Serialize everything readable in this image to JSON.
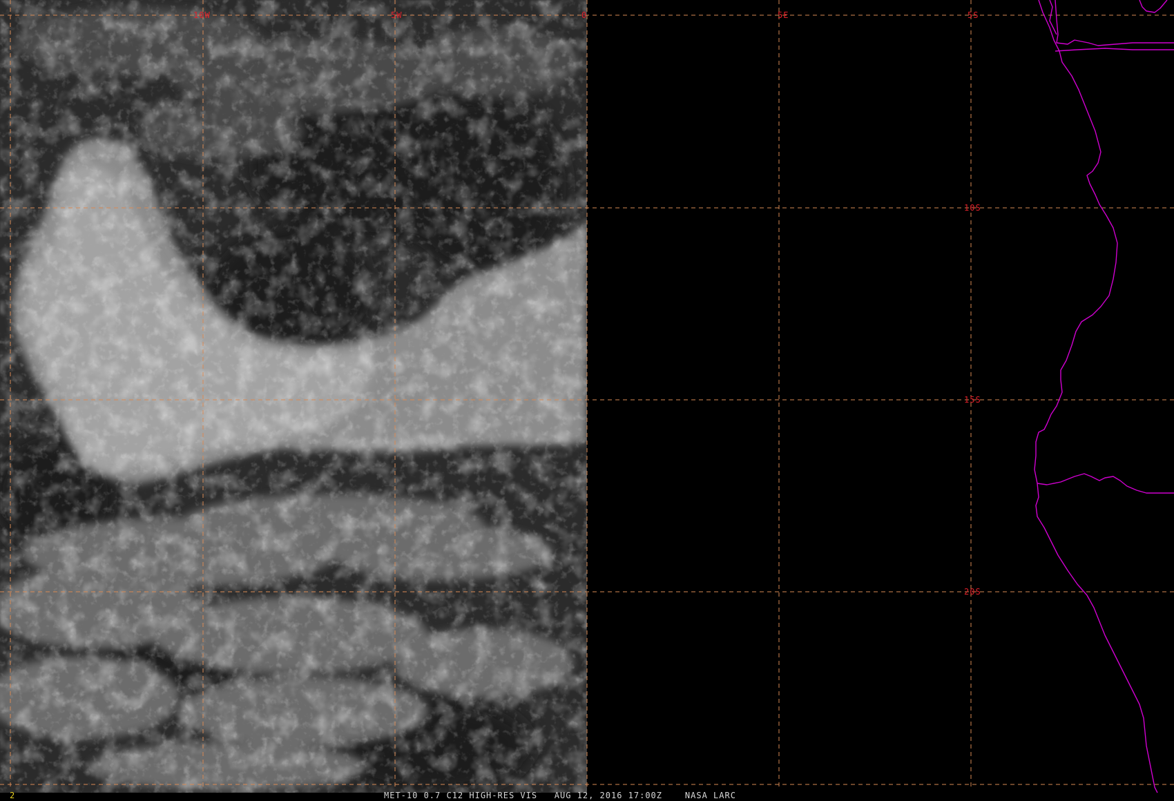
{
  "image": {
    "caption": "MET-10 0.7 C12 HIGH-RES VIS   AUG 12, 2016 17:00Z    NASA LARC",
    "frame_number": "2"
  },
  "grid": {
    "longitude_labels": [
      "10W",
      "5W",
      "0",
      "5E"
    ],
    "latitude_labels": [
      "5S",
      "10S",
      "15S",
      "20S"
    ]
  },
  "colors": {
    "grid_line": "#d88a55",
    "grid_label": "#e0202a",
    "coastline": "#d000d0",
    "caption_text": "#d8d8d8",
    "frame_number": "#e8d020",
    "background": "#000000"
  }
}
